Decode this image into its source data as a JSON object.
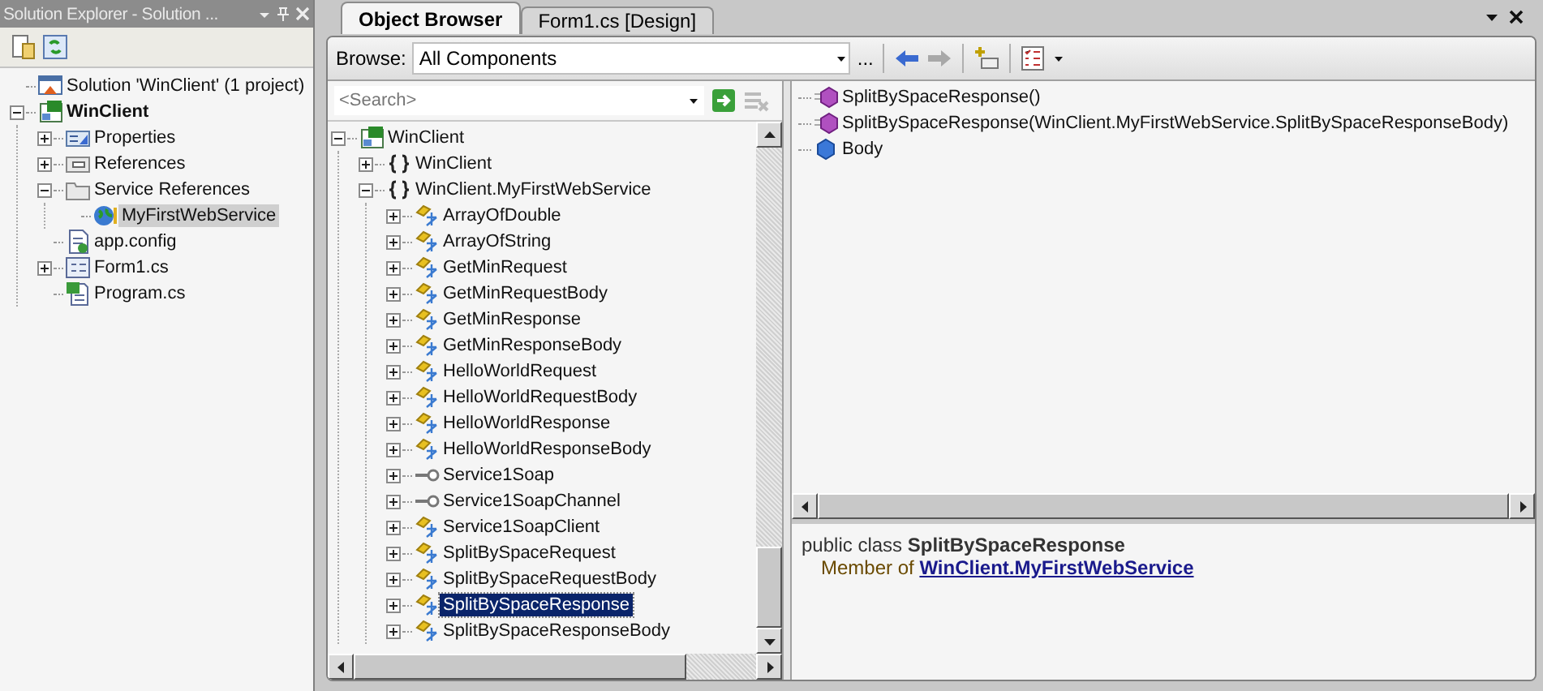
{
  "solution_explorer": {
    "title": "Solution Explorer - Solution ...",
    "tree": [
      {
        "label": "Solution 'WinClient' (1 project)",
        "kind": "solution",
        "selected": false,
        "bold": false
      },
      {
        "label": "WinClient",
        "kind": "project",
        "selected": false,
        "bold": true,
        "expanded": true,
        "children": [
          {
            "label": "Properties",
            "kind": "properties",
            "selected": false,
            "bold": false,
            "expanded": false
          },
          {
            "label": "References",
            "kind": "references",
            "selected": false,
            "bold": false,
            "expanded": false
          },
          {
            "label": "Service References",
            "kind": "folder",
            "selected": false,
            "bold": false,
            "expanded": true,
            "children": [
              {
                "label": "MyFirstWebService",
                "kind": "service",
                "selected": true,
                "bold": false
              }
            ]
          },
          {
            "label": "app.config",
            "kind": "config",
            "selected": false,
            "bold": false
          },
          {
            "label": "Form1.cs",
            "kind": "form",
            "selected": false,
            "bold": false,
            "expanded": false
          },
          {
            "label": "Program.cs",
            "kind": "csharp",
            "selected": false,
            "bold": false
          }
        ]
      }
    ]
  },
  "tabs": [
    {
      "label": "Object Browser",
      "selected": true
    },
    {
      "label": "Form1.cs [Design]",
      "selected": false
    }
  ],
  "browse": {
    "label": "Browse:",
    "value": "All Components",
    "more": "..."
  },
  "search": {
    "placeholder": "<Search>"
  },
  "objects": [
    {
      "label": "WinClient",
      "kind": "project",
      "selected": false,
      "expanded": true,
      "children": [
        {
          "label": "WinClient",
          "kind": "namespace",
          "selected": false,
          "expanded": false
        },
        {
          "label": "WinClient.MyFirstWebService",
          "kind": "namespace",
          "selected": false,
          "expanded": true,
          "children": [
            {
              "label": "ArrayOfDouble",
              "kind": "class",
              "selected": false,
              "expanded": false
            },
            {
              "label": "ArrayOfString",
              "kind": "class",
              "selected": false,
              "expanded": false
            },
            {
              "label": "GetMinRequest",
              "kind": "class",
              "selected": false,
              "expanded": false
            },
            {
              "label": "GetMinRequestBody",
              "kind": "class",
              "selected": false,
              "expanded": false
            },
            {
              "label": "GetMinResponse",
              "kind": "class",
              "selected": false,
              "expanded": false
            },
            {
              "label": "GetMinResponseBody",
              "kind": "class",
              "selected": false,
              "expanded": false
            },
            {
              "label": "HelloWorldRequest",
              "kind": "class",
              "selected": false,
              "expanded": false
            },
            {
              "label": "HelloWorldRequestBody",
              "kind": "class",
              "selected": false,
              "expanded": false
            },
            {
              "label": "HelloWorldResponse",
              "kind": "class",
              "selected": false,
              "expanded": false
            },
            {
              "label": "HelloWorldResponseBody",
              "kind": "class",
              "selected": false,
              "expanded": false
            },
            {
              "label": "Service1Soap",
              "kind": "interface",
              "selected": false,
              "expanded": false
            },
            {
              "label": "Service1SoapChannel",
              "kind": "interface",
              "selected": false,
              "expanded": false
            },
            {
              "label": "Service1SoapClient",
              "kind": "class",
              "selected": false,
              "expanded": false
            },
            {
              "label": "SplitBySpaceRequest",
              "kind": "class",
              "selected": false,
              "expanded": false
            },
            {
              "label": "SplitBySpaceRequestBody",
              "kind": "class",
              "selected": false,
              "expanded": false
            },
            {
              "label": "SplitBySpaceResponse",
              "kind": "class",
              "selected": true,
              "expanded": false
            },
            {
              "label": "SplitBySpaceResponseBody",
              "kind": "class",
              "selected": false,
              "expanded": false
            }
          ]
        }
      ]
    }
  ],
  "members": [
    {
      "label": "SplitBySpaceResponse()",
      "kind": "method",
      "selected": false
    },
    {
      "label": "SplitBySpaceResponse(WinClient.MyFirstWebService.SplitBySpaceResponseBody)",
      "kind": "method",
      "selected": false
    },
    {
      "label": "Body",
      "kind": "field",
      "selected": false
    }
  ],
  "description": {
    "declaration": "public class **SplitBySpaceResponse**",
    "member_of": "Member of",
    "link": "WinClient.MyFirstWebService"
  }
}
